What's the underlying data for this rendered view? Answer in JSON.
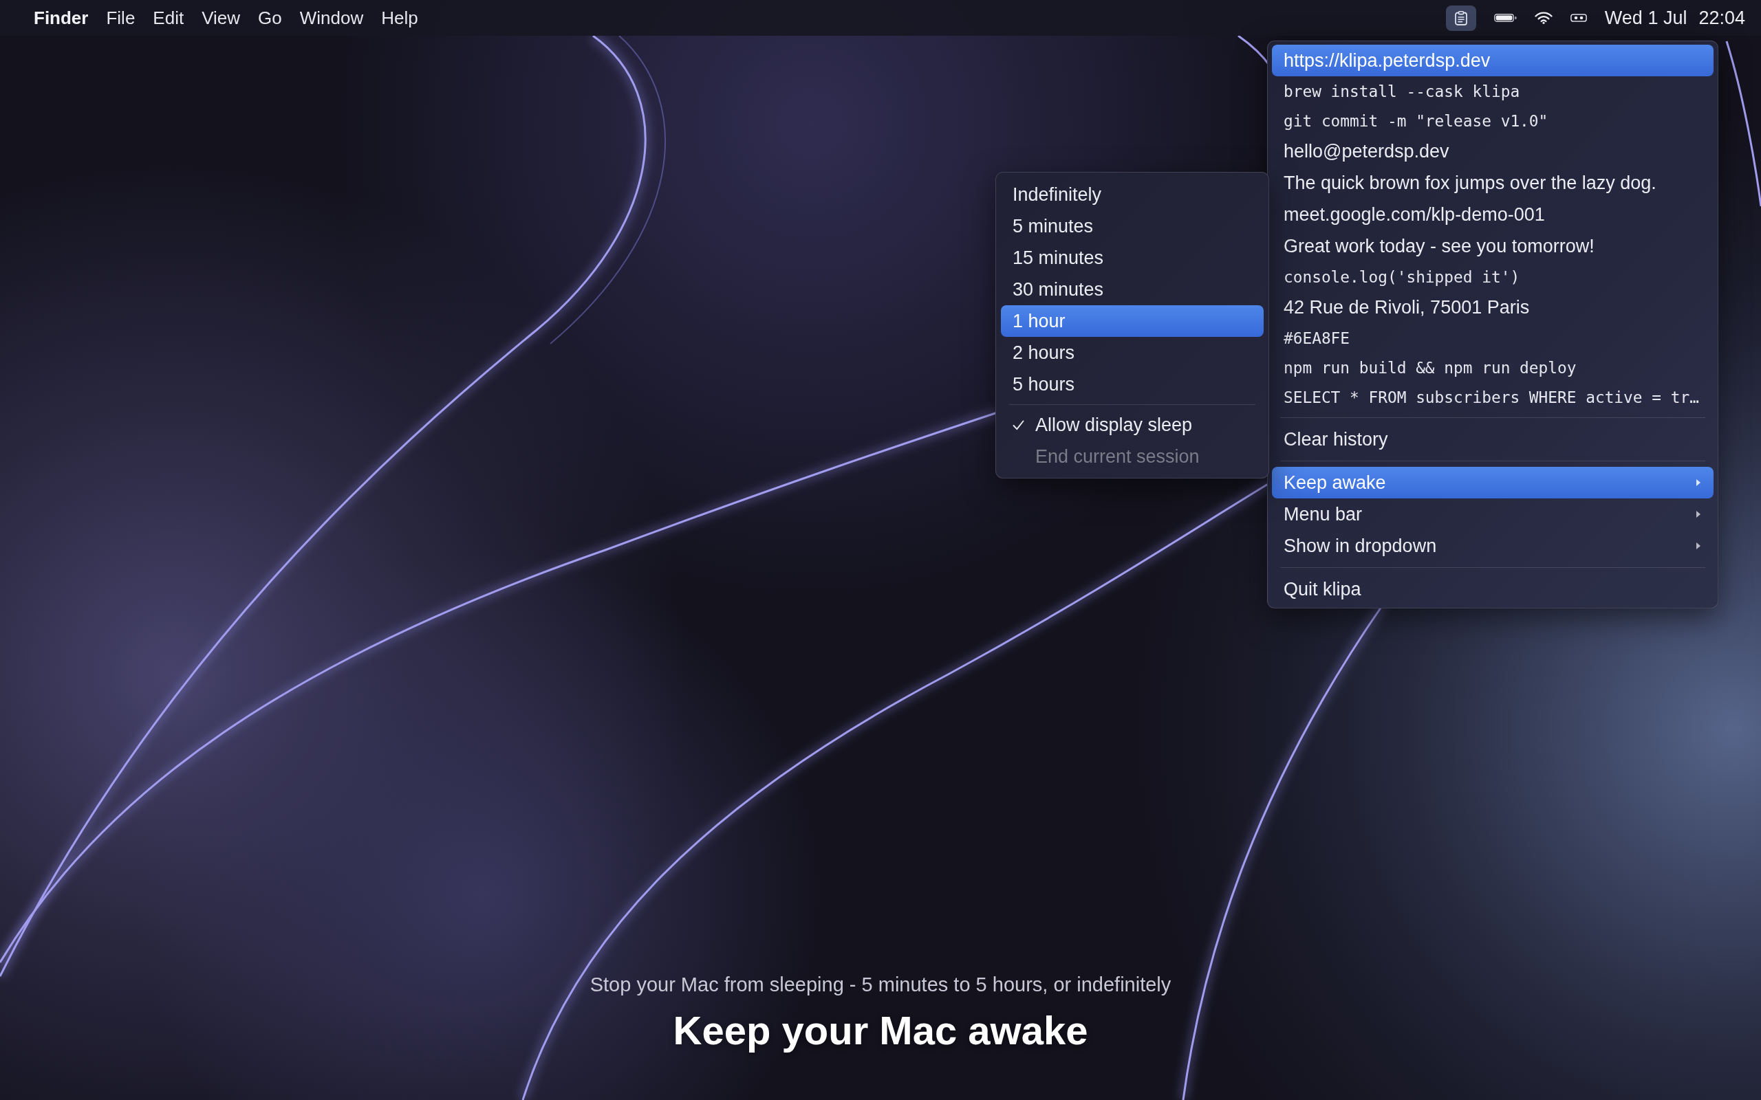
{
  "menu_bar": {
    "app_name": "Finder",
    "menus": [
      "File",
      "Edit",
      "View",
      "Go",
      "Window",
      "Help"
    ],
    "extras": [
      {
        "kind": "clipboard",
        "active": true
      },
      {
        "kind": "battery",
        "active": false
      },
      {
        "kind": "wifi",
        "active": false
      },
      {
        "kind": "capsule",
        "active": false
      }
    ],
    "date": "Wed 1 Jul",
    "time": "22:04"
  },
  "clipboard_menu": {
    "sections": [
      {
        "items": [
          {
            "label": "https://klipa.peterdsp.dev",
            "kind": "text",
            "selected": true,
            "submenu": false
          },
          {
            "label": "brew install --cask klipa",
            "kind": "code",
            "selected": false,
            "submenu": false
          },
          {
            "label": "git commit -m \"release v1.0\"",
            "kind": "code",
            "selected": false,
            "submenu": false
          },
          {
            "label": "hello@peterdsp.dev",
            "kind": "text",
            "selected": false,
            "submenu": false
          },
          {
            "label": "The quick brown fox jumps over the lazy dog.",
            "kind": "text",
            "selected": false,
            "submenu": false
          },
          {
            "label": "meet.google.com/klp-demo-001",
            "kind": "text",
            "selected": false,
            "submenu": false
          },
          {
            "label": "Great work today - see you tomorrow!",
            "kind": "text",
            "selected": false,
            "submenu": false
          },
          {
            "label": "console.log('shipped it')",
            "kind": "code",
            "selected": false,
            "submenu": false
          },
          {
            "label": "42 Rue de Rivoli, 75001 Paris",
            "kind": "text",
            "selected": false,
            "submenu": false
          },
          {
            "label": "#6EA8FE",
            "kind": "code",
            "selected": false,
            "submenu": false
          },
          {
            "label": "npm run build && npm run deploy",
            "kind": "code",
            "selected": false,
            "submenu": false
          },
          {
            "label": "SELECT * FROM subscribers WHERE active = tr…",
            "kind": "code",
            "selected": false,
            "submenu": false
          }
        ]
      },
      {
        "items": [
          {
            "label": "Clear history",
            "kind": "text",
            "selected": false,
            "submenu": false
          }
        ]
      },
      {
        "items": [
          {
            "label": "Keep awake",
            "kind": "text",
            "selected": true,
            "submenu": true
          },
          {
            "label": "Menu bar",
            "kind": "text",
            "selected": false,
            "submenu": true
          },
          {
            "label": "Show in dropdown",
            "kind": "text",
            "selected": false,
            "submenu": true
          }
        ]
      },
      {
        "items": [
          {
            "label": "Quit klipa",
            "kind": "text",
            "selected": false,
            "submenu": false
          }
        ]
      }
    ]
  },
  "keep_awake_submenu": {
    "durations": [
      {
        "label": "Indefinitely",
        "selected": false
      },
      {
        "label": "5 minutes",
        "selected": false
      },
      {
        "label": "15 minutes",
        "selected": false
      },
      {
        "label": "30 minutes",
        "selected": false
      },
      {
        "label": "1 hour",
        "selected": true
      },
      {
        "label": "2 hours",
        "selected": false
      },
      {
        "label": "5 hours",
        "selected": false
      }
    ],
    "options": [
      {
        "label": "Allow display sleep",
        "checked": true,
        "disabled": false
      },
      {
        "label": "End current session",
        "checked": false,
        "disabled": true
      }
    ]
  },
  "promo": {
    "caption": "Stop your Mac from sleeping - 5 minutes to 5 hours, or indefinitely",
    "headline": "Keep your Mac awake"
  }
}
